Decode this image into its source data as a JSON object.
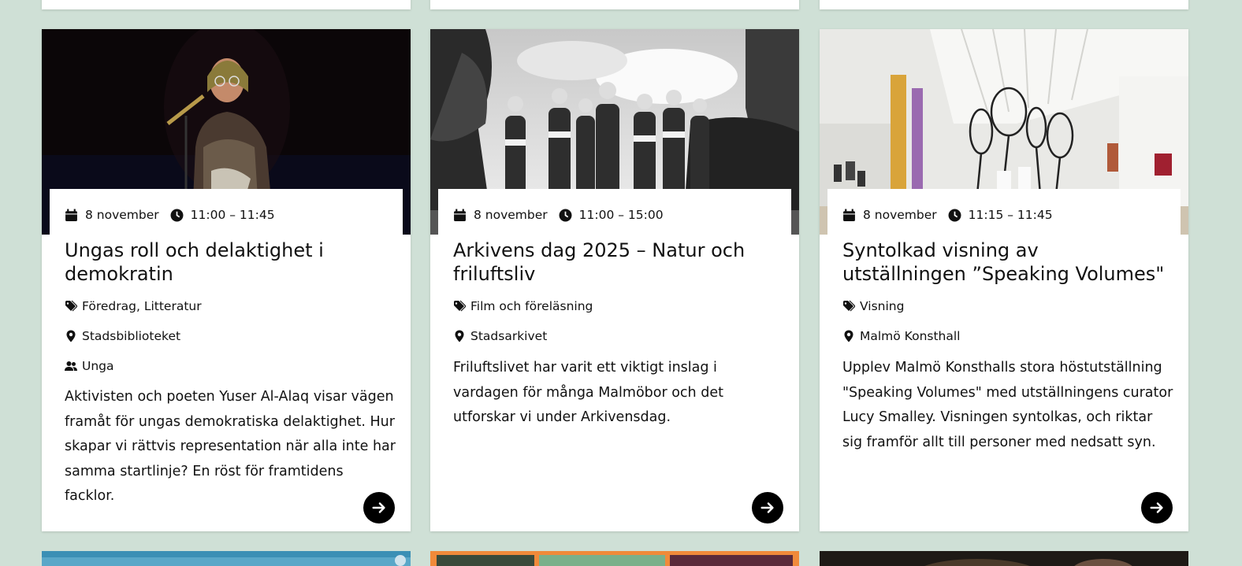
{
  "colors": {
    "page_background": "#cfe0d6",
    "card_background": "#ffffff",
    "button_background": "#000000"
  },
  "cards": [
    {
      "date": "8 november",
      "time": "11:00 – 11:45",
      "title": "Ungas roll och delaktighet i demokratin",
      "category": "Föredrag, Litteratur",
      "location": "Stadsbiblioteket",
      "audience": "Unga",
      "description": "Aktivisten och poeten Yuser Al-Alaq visar vägen framåt för ungas demokratiska delaktighet. Hur skapar vi rättvis representation när alla inte har samma startlinje? En röst för framtidens facklor.",
      "image": "speaker-on-stage-photo"
    },
    {
      "date": "8 november",
      "time": "11:00 – 15:00",
      "title": "Arkivens dag 2025 – Natur och friluftsliv",
      "category": "Film och föreläsning",
      "location": "Stadsarkivet",
      "description": "Friluftslivet har varit ett viktigt inslag i vardagen för många Malmöbor och det utforskar vi under Arkivensdag.",
      "image": "black-white-hikers-photo"
    },
    {
      "date": "8 november",
      "time": "11:15 – 11:45",
      "title": "Syntolkad visning av utställningen ”Speaking Volumes\"",
      "category": "Visning",
      "location": "Malmö Konsthall",
      "description": "Upplev Malmö Konsthalls stora höstutställning \"Speaking Volumes\" med utställningens curator Lucy Smalley. Visningen syntolkas, och riktar sig framför allt till personer med nedsatt syn.",
      "image": "gallery-exhibition-photo"
    }
  ]
}
